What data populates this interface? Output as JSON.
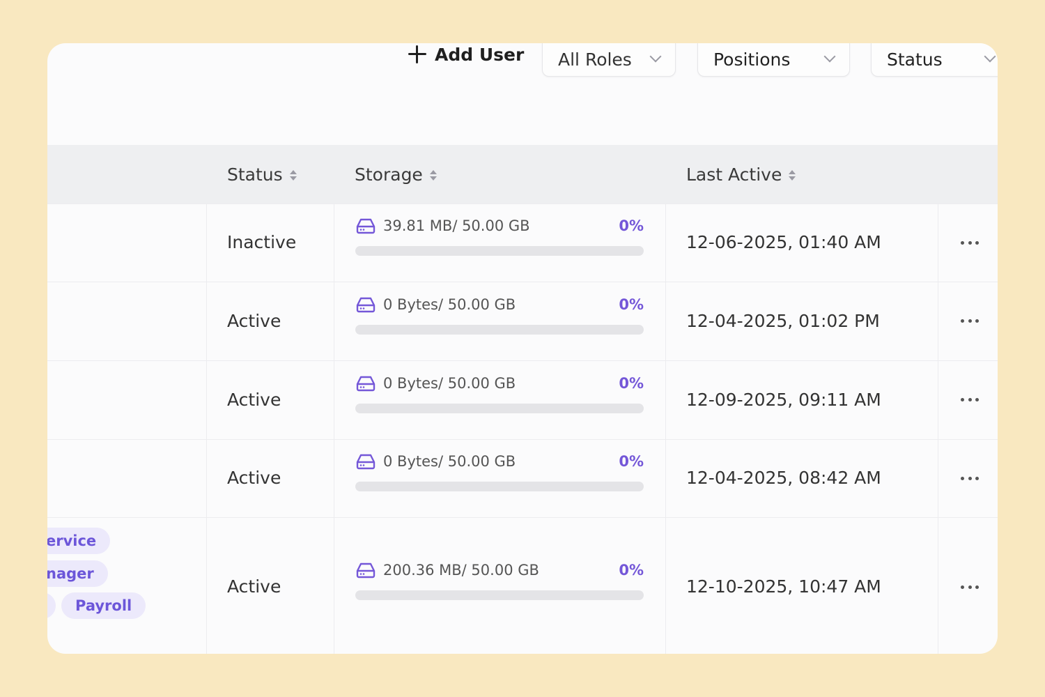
{
  "toolbar": {
    "add_user_label": "Add User",
    "filters": [
      {
        "label": "All Roles"
      },
      {
        "label": "Positions"
      },
      {
        "label": "Status"
      }
    ]
  },
  "table": {
    "columns": [
      {
        "label": "Status"
      },
      {
        "label": "Storage"
      },
      {
        "label": "Last Active"
      }
    ],
    "rows": [
      {
        "status": "Inactive",
        "storage": "39.81 MB/ 50.00 GB",
        "percent": "0%",
        "usage_fraction": 0,
        "last_active": "12-06-2025, 01:40 AM"
      },
      {
        "status": "Active",
        "storage": "0 Bytes/ 50.00 GB",
        "percent": "0%",
        "usage_fraction": 0,
        "last_active": "12-04-2025, 01:02 PM"
      },
      {
        "status": "Active",
        "storage": "0 Bytes/ 50.00 GB",
        "percent": "0%",
        "usage_fraction": 0,
        "last_active": "12-09-2025, 09:11 AM"
      },
      {
        "status": "Active",
        "storage": "0 Bytes/ 50.00 GB",
        "percent": "0%",
        "usage_fraction": 0,
        "last_active": "12-04-2025, 08:42 AM"
      },
      {
        "status": "Active",
        "storage": "200.36 MB/ 50.00 GB",
        "percent": "0%",
        "usage_fraction": 0,
        "last_active": "12-10-2025, 10:47 AM",
        "tags": [
          "ervice",
          "nager",
          "Payroll"
        ]
      }
    ]
  },
  "colors": {
    "accent": "#7457d8",
    "background": "#f9e8c0",
    "card": "#fbfbfc",
    "tag_bg": "#ece9fb"
  },
  "icons": {
    "add": "plus-icon",
    "dropdown": "chevron-down-icon",
    "sort": "sort-icon",
    "storage": "hard-drive-icon",
    "row_menu": "more-horizontal-icon"
  }
}
